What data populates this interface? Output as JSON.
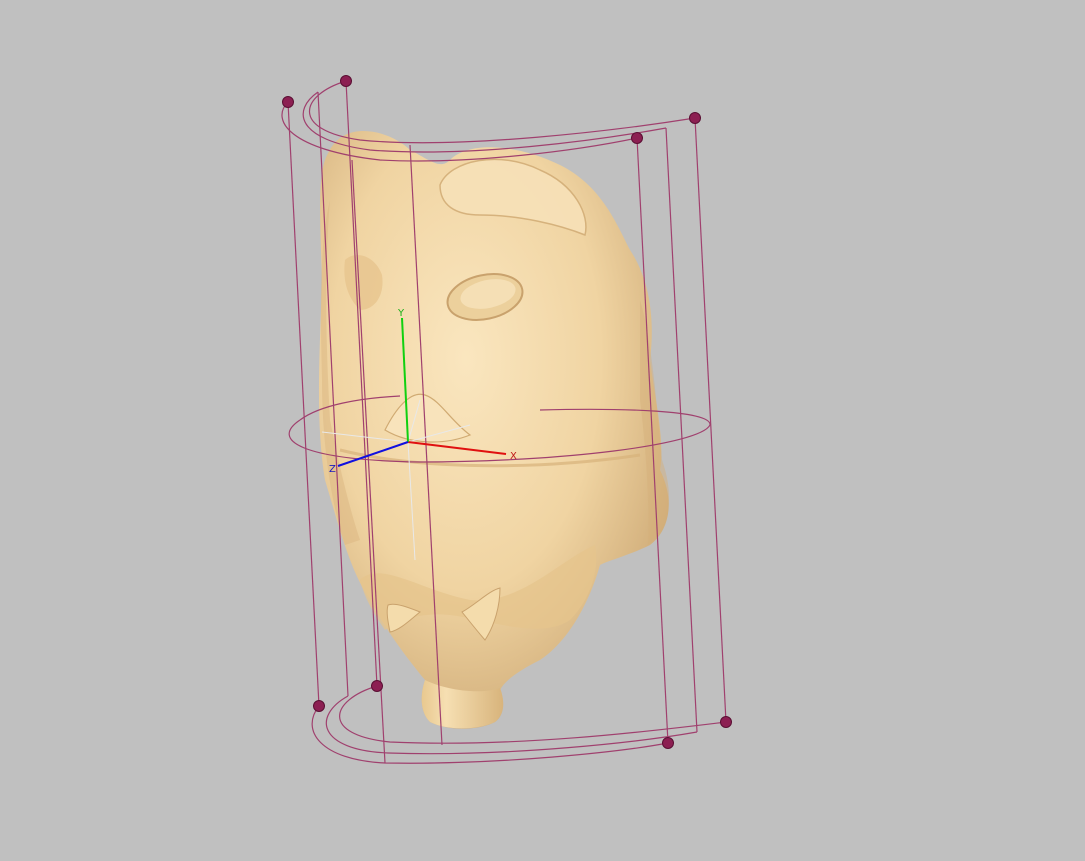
{
  "viewport": {
    "background": "#c0c0c0",
    "mesh_color": "#f2d7a8",
    "mesh_shadow": "#c9a674",
    "lattice_color": "#a0406e",
    "control_point_color": "#8c1f52"
  },
  "gizmo": {
    "x_label": "X",
    "y_label": "Y",
    "z_label": "Z",
    "x_color": "#e01010",
    "y_color": "#10d010",
    "z_color": "#1010e0"
  }
}
